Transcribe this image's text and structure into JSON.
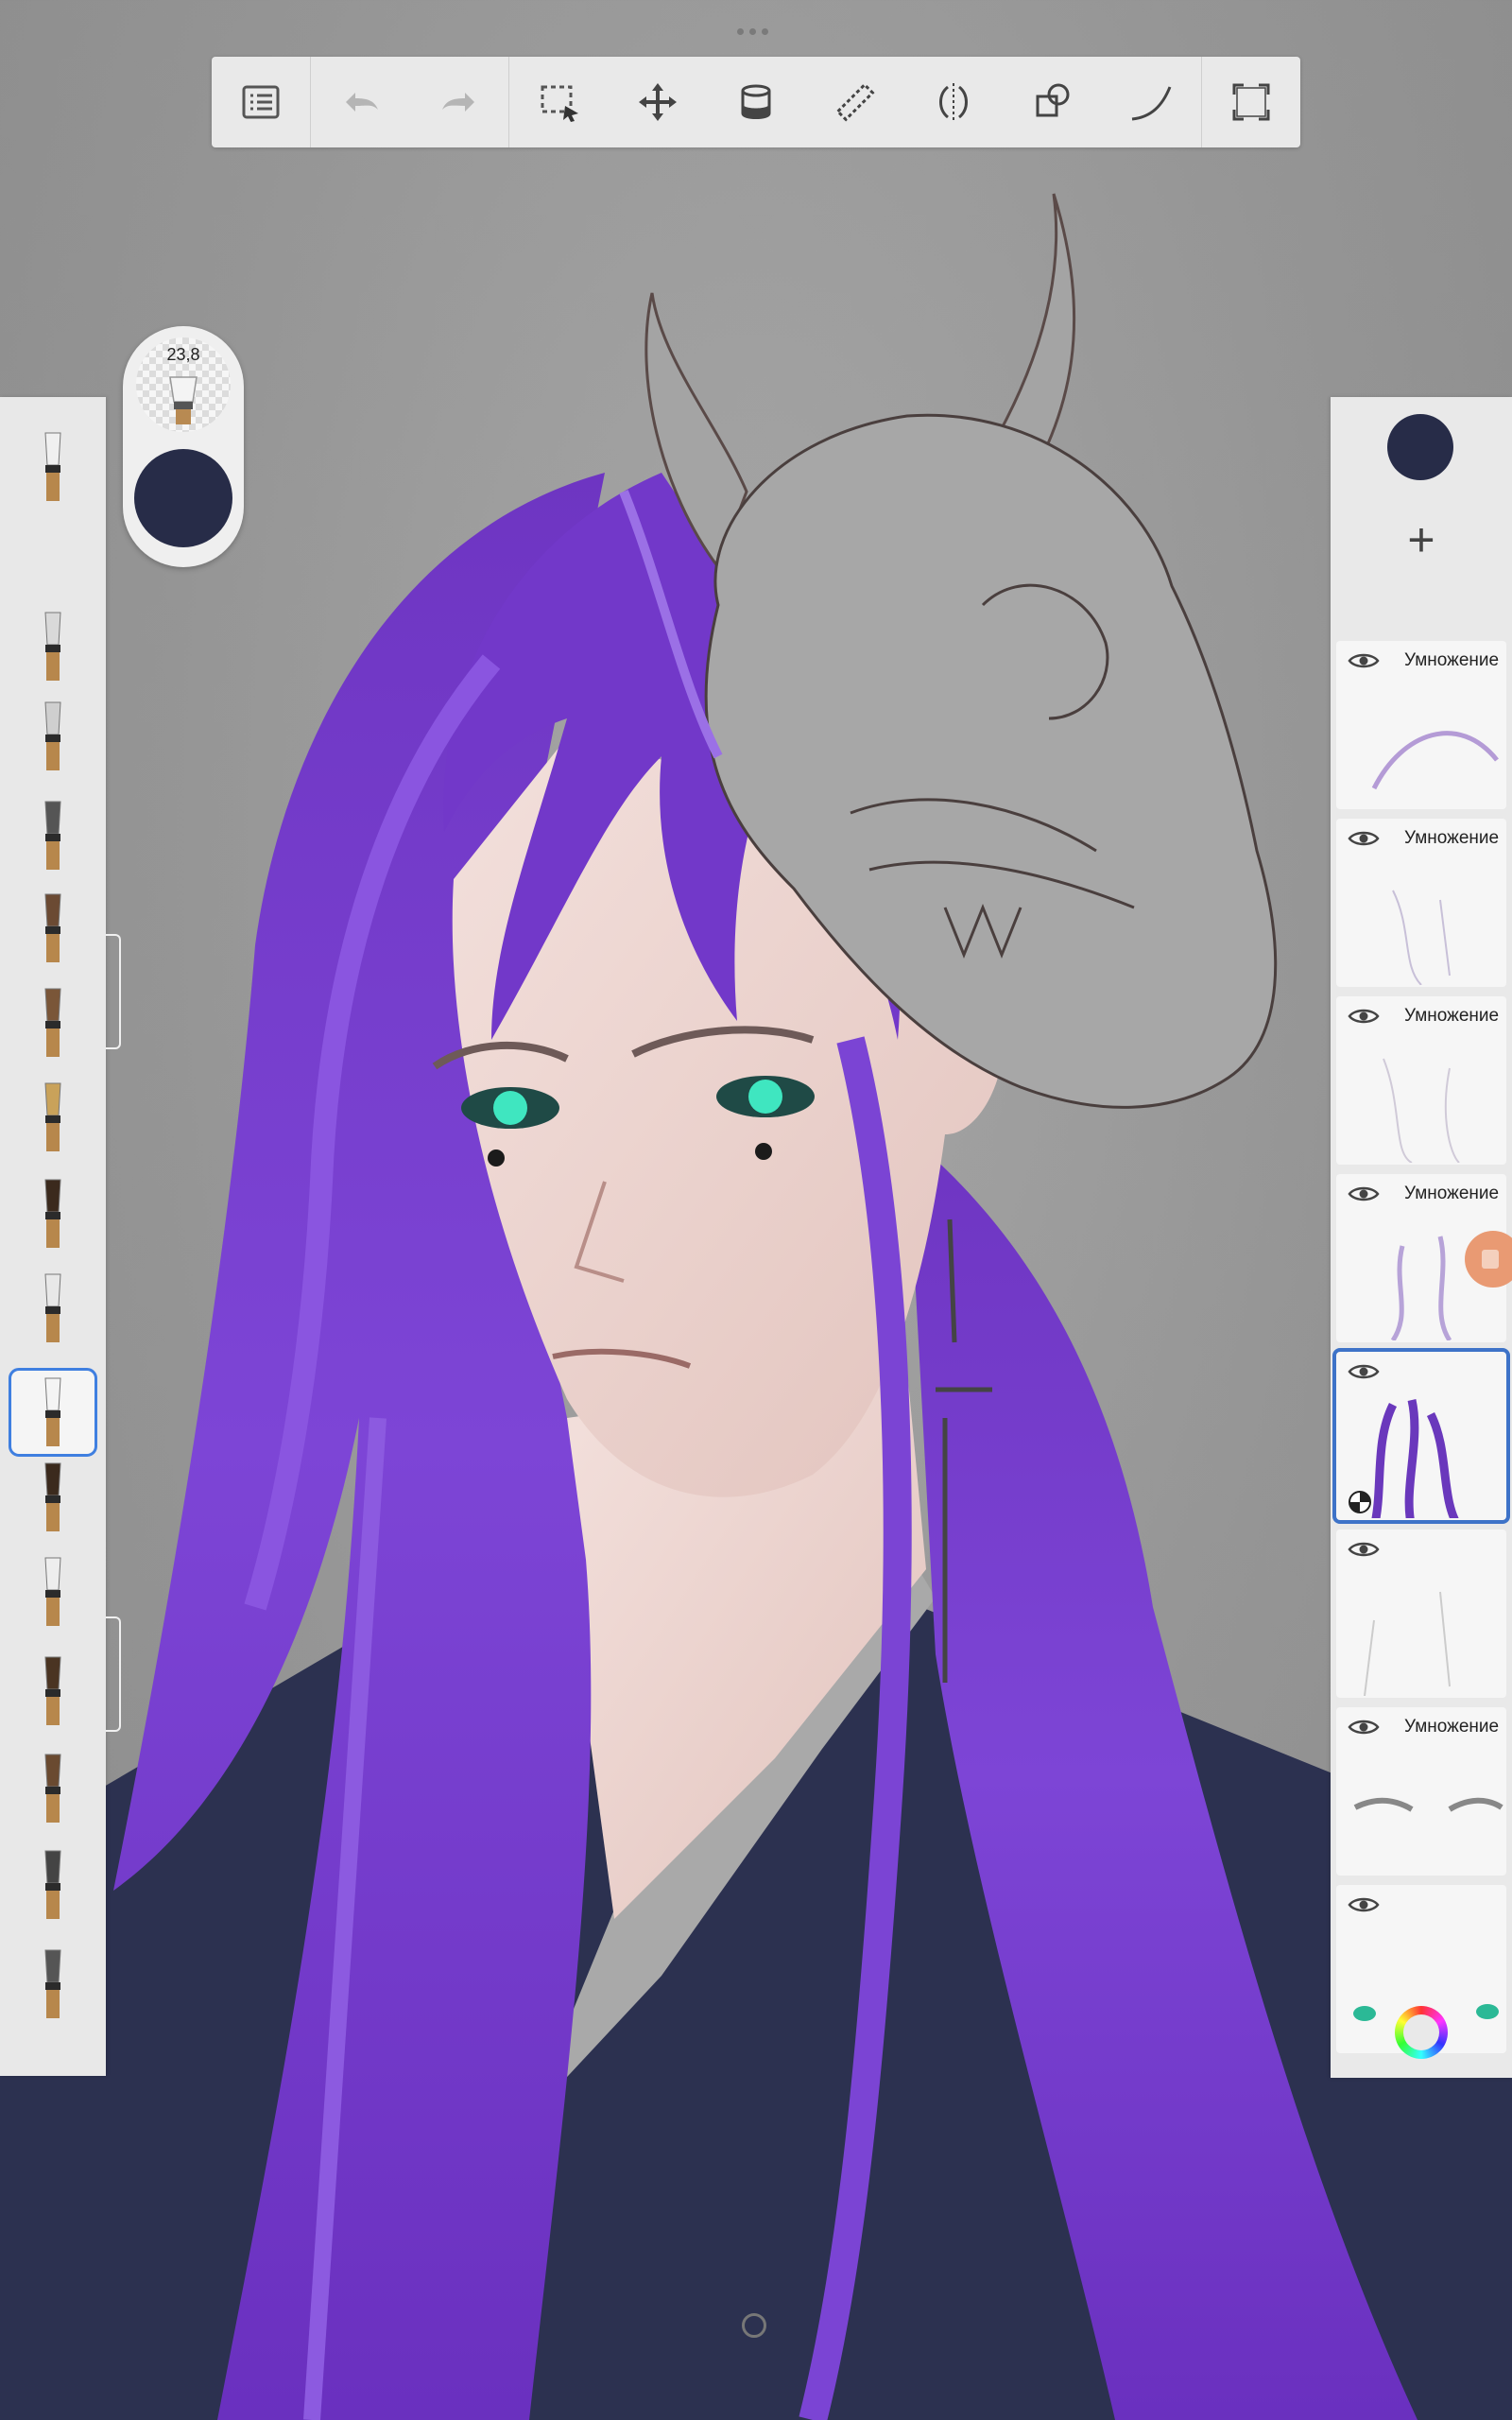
{
  "app": {
    "toolbar": {
      "items": [
        {
          "name": "menu-icon"
        },
        {
          "name": "undo-icon"
        },
        {
          "name": "redo-icon"
        },
        {
          "name": "selection-icon"
        },
        {
          "name": "transform-icon"
        },
        {
          "name": "fill-bucket-icon"
        },
        {
          "name": "ruler-icon"
        },
        {
          "name": "symmetry-icon"
        },
        {
          "name": "shapes-icon"
        },
        {
          "name": "curve-icon"
        },
        {
          "name": "fullscreen-icon"
        }
      ]
    },
    "brush_size": {
      "value": "23,8"
    },
    "current_color": "#272c48",
    "brushes": [
      {
        "name": "airbrush"
      },
      {
        "name": "pencil"
      },
      {
        "name": "pencil-soft"
      },
      {
        "name": "marker"
      },
      {
        "name": "paintbrush"
      },
      {
        "name": "paintbrush-round"
      },
      {
        "name": "ink-pen"
      },
      {
        "name": "fan-brush"
      },
      {
        "name": "smudge"
      },
      {
        "name": "bristle-brush",
        "selected": true
      },
      {
        "name": "flat-brush"
      },
      {
        "name": "hard-brush"
      },
      {
        "name": "splatter-brush"
      },
      {
        "name": "round-brush"
      },
      {
        "name": "eraser"
      },
      {
        "name": "eraser-soft"
      }
    ],
    "layers": {
      "add_label": "+",
      "items": [
        {
          "blend": "Умножение",
          "visible": true
        },
        {
          "blend": "Умножение",
          "visible": true
        },
        {
          "blend": "Умножение",
          "visible": true
        },
        {
          "blend": "Умножение",
          "visible": true
        },
        {
          "blend": "",
          "visible": true,
          "selected": true
        },
        {
          "blend": "",
          "visible": true
        },
        {
          "blend": "Умножение",
          "visible": true
        },
        {
          "blend": "",
          "visible": true
        }
      ]
    }
  }
}
